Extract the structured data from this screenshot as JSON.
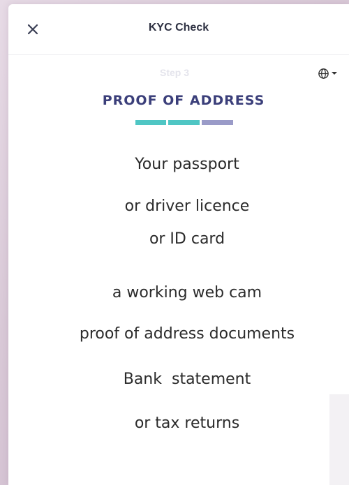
{
  "header": {
    "title": "KYC Check",
    "close_icon": "close-icon"
  },
  "language": {
    "icon": "globe-icon",
    "dropdown_icon": "caret-down-icon"
  },
  "step": {
    "label": "Step 3",
    "title": "PROOF OF ADDRESS",
    "progress_colors": [
      "#4fc6c4",
      "#4fc6c4",
      "#9a9bc8"
    ]
  },
  "requirements": [
    "Your passport",
    "or driver licence",
    "or ID card",
    "a working web cam",
    "proof of address documents",
    "Bank  statement",
    "or tax returns"
  ]
}
